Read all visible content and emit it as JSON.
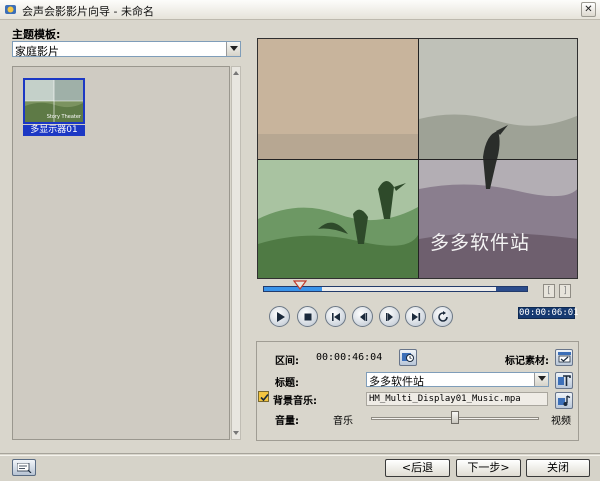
{
  "window": {
    "title": "会声会影影片向导 - 未命名",
    "close_glyph": "✕"
  },
  "theme": {
    "label": "主题模板:",
    "selected": "家庭影片",
    "templates": [
      {
        "name": "多显示器01",
        "overlay_text": "Story Theater"
      }
    ]
  },
  "preview": {
    "watermark": "多多软件站"
  },
  "playback": {
    "timecode": "00:00:06:01",
    "progress": 0.22,
    "bracket_in": "[",
    "bracket_out": "]"
  },
  "info": {
    "duration_label": "区间:",
    "duration_value": "00:00:46:04",
    "mark_label": "标记素材:",
    "title_label": "标题:",
    "title_value": "多多软件站",
    "music_label": "背景音乐:",
    "music_file": "HM_Multi_Display01_Music.mpa",
    "music_checked": true,
    "volume_label": "音量:",
    "volume_left": "音乐",
    "volume_right": "视频",
    "volume_balance": 0.5
  },
  "nav": {
    "back": "<后退",
    "next": "下一步>",
    "close": "关闭"
  },
  "colors": {
    "accent": "#1c38c4",
    "timeline": "#3a93ea",
    "timecode_bg": "#163a71"
  }
}
